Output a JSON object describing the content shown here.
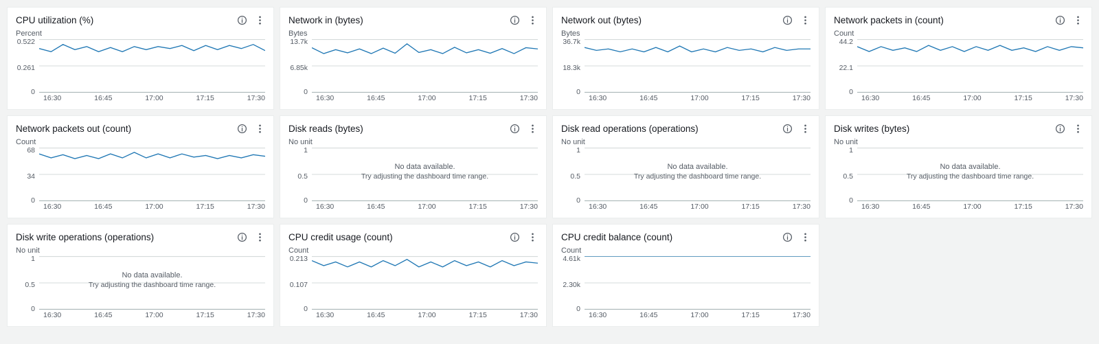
{
  "common": {
    "x_ticks": [
      "16:30",
      "16:45",
      "17:00",
      "17:15",
      "17:30"
    ],
    "no_data_line1": "No data available.",
    "no_data_line2": "Try adjusting the dashboard time range."
  },
  "cards": [
    {
      "id": "cpu-util",
      "title": "CPU utilization (%)",
      "unit": "Percent",
      "y_ticks": [
        "0.522",
        "0.261",
        "0"
      ],
      "has_data": true,
      "values": [
        0.43,
        0.4,
        0.47,
        0.42,
        0.45,
        0.4,
        0.44,
        0.4,
        0.45,
        0.42,
        0.45,
        0.43,
        0.46,
        0.41,
        0.46,
        0.42,
        0.46,
        0.43,
        0.47,
        0.41
      ],
      "ymax": 0.522
    },
    {
      "id": "net-in",
      "title": "Network in (bytes)",
      "unit": "Bytes",
      "y_ticks": [
        "13.7k",
        "6.85k",
        "0"
      ],
      "has_data": true,
      "values": [
        11.5,
        10.0,
        11.0,
        10.2,
        11.2,
        10.0,
        11.4,
        10.1,
        12.5,
        10.3,
        11.0,
        10.0,
        11.6,
        10.2,
        11.0,
        10.1,
        11.3,
        10.0,
        11.5,
        11.2
      ],
      "ymax": 13.7
    },
    {
      "id": "net-out",
      "title": "Network out (bytes)",
      "unit": "Bytes",
      "y_ticks": [
        "36.7k",
        "18.3k",
        "0"
      ],
      "has_data": true,
      "values": [
        31,
        29,
        30,
        28,
        30,
        28,
        31,
        28,
        32,
        28,
        30,
        28,
        31,
        29,
        30,
        28,
        31,
        29,
        30,
        30
      ],
      "ymax": 36.7
    },
    {
      "id": "net-pkt-in",
      "title": "Network packets in (count)",
      "unit": "Count",
      "y_ticks": [
        "44.2",
        "22.1",
        "0"
      ],
      "has_data": true,
      "values": [
        38,
        34,
        38,
        35,
        37,
        34,
        39,
        35,
        38,
        34,
        38,
        35,
        39,
        35,
        37,
        34,
        38,
        35,
        38,
        37
      ],
      "ymax": 44.2
    },
    {
      "id": "net-pkt-out",
      "title": "Network packets out (count)",
      "unit": "Count",
      "y_ticks": [
        "68",
        "34",
        "0"
      ],
      "has_data": true,
      "values": [
        60,
        55,
        59,
        54,
        58,
        54,
        60,
        55,
        62,
        55,
        60,
        55,
        60,
        56,
        58,
        54,
        58,
        55,
        59,
        57
      ],
      "ymax": 68
    },
    {
      "id": "disk-reads",
      "title": "Disk reads (bytes)",
      "unit": "No unit",
      "y_ticks": [
        "1",
        "0.5",
        "0"
      ],
      "has_data": false,
      "values": [],
      "ymax": 1
    },
    {
      "id": "disk-read-ops",
      "title": "Disk read operations (operations)",
      "unit": "No unit",
      "y_ticks": [
        "1",
        "0.5",
        "0"
      ],
      "has_data": false,
      "values": [],
      "ymax": 1
    },
    {
      "id": "disk-writes",
      "title": "Disk writes (bytes)",
      "unit": "No unit",
      "y_ticks": [
        "1",
        "0.5",
        "0"
      ],
      "has_data": false,
      "values": [],
      "ymax": 1
    },
    {
      "id": "disk-write-ops",
      "title": "Disk write operations (operations)",
      "unit": "No unit",
      "y_ticks": [
        "1",
        "0.5",
        "0"
      ],
      "has_data": false,
      "values": [],
      "ymax": 1
    },
    {
      "id": "cpu-credit-usage",
      "title": "CPU credit usage (count)",
      "unit": "Count",
      "y_ticks": [
        "0.213",
        "0.107",
        "0"
      ],
      "has_data": true,
      "values": [
        0.195,
        0.175,
        0.19,
        0.17,
        0.19,
        0.17,
        0.195,
        0.175,
        0.2,
        0.17,
        0.19,
        0.17,
        0.195,
        0.175,
        0.19,
        0.17,
        0.195,
        0.175,
        0.19,
        0.185
      ],
      "ymax": 0.213
    },
    {
      "id": "cpu-credit-balance",
      "title": "CPU credit balance (count)",
      "unit": "Count",
      "y_ticks": [
        "4.61k",
        "2.30k",
        "0"
      ],
      "has_data": true,
      "values": [
        4.61,
        4.61,
        4.61,
        4.61,
        4.61,
        4.61,
        4.61,
        4.61,
        4.61,
        4.61,
        4.61,
        4.61,
        4.61,
        4.61,
        4.61,
        4.61,
        4.61,
        4.61,
        4.61,
        4.61
      ],
      "ymax": 4.61
    }
  ],
  "chart_data": [
    {
      "type": "line",
      "title": "CPU utilization (%)",
      "xlabel": "",
      "ylabel": "Percent",
      "x": [
        "16:30",
        "16:45",
        "17:00",
        "17:15",
        "17:30"
      ],
      "ylim": [
        0,
        0.522
      ],
      "series": [
        {
          "name": "CPU utilization",
          "values": [
            0.43,
            0.4,
            0.47,
            0.42,
            0.45,
            0.4,
            0.44,
            0.4,
            0.45,
            0.42,
            0.45,
            0.43,
            0.46,
            0.41,
            0.46,
            0.42,
            0.46,
            0.43,
            0.47,
            0.41
          ]
        }
      ]
    },
    {
      "type": "line",
      "title": "Network in (bytes)",
      "xlabel": "",
      "ylabel": "Bytes",
      "x": [
        "16:30",
        "16:45",
        "17:00",
        "17:15",
        "17:30"
      ],
      "ylim": [
        0,
        13700
      ],
      "series": [
        {
          "name": "Network in",
          "values": [
            11500,
            10000,
            11000,
            10200,
            11200,
            10000,
            11400,
            10100,
            12500,
            10300,
            11000,
            10000,
            11600,
            10200,
            11000,
            10100,
            11300,
            10000,
            11500,
            11200
          ]
        }
      ]
    },
    {
      "type": "line",
      "title": "Network out (bytes)",
      "xlabel": "",
      "ylabel": "Bytes",
      "x": [
        "16:30",
        "16:45",
        "17:00",
        "17:15",
        "17:30"
      ],
      "ylim": [
        0,
        36700
      ],
      "series": [
        {
          "name": "Network out",
          "values": [
            31000,
            29000,
            30000,
            28000,
            30000,
            28000,
            31000,
            28000,
            32000,
            28000,
            30000,
            28000,
            31000,
            29000,
            30000,
            28000,
            31000,
            29000,
            30000,
            30000
          ]
        }
      ]
    },
    {
      "type": "line",
      "title": "Network packets in (count)",
      "xlabel": "",
      "ylabel": "Count",
      "x": [
        "16:30",
        "16:45",
        "17:00",
        "17:15",
        "17:30"
      ],
      "ylim": [
        0,
        44.2
      ],
      "series": [
        {
          "name": "Network packets in",
          "values": [
            38,
            34,
            38,
            35,
            37,
            34,
            39,
            35,
            38,
            34,
            38,
            35,
            39,
            35,
            37,
            34,
            38,
            35,
            38,
            37
          ]
        }
      ]
    },
    {
      "type": "line",
      "title": "Network packets out (count)",
      "xlabel": "",
      "ylabel": "Count",
      "x": [
        "16:30",
        "16:45",
        "17:00",
        "17:15",
        "17:30"
      ],
      "ylim": [
        0,
        68
      ],
      "series": [
        {
          "name": "Network packets out",
          "values": [
            60,
            55,
            59,
            54,
            58,
            54,
            60,
            55,
            62,
            55,
            60,
            55,
            60,
            56,
            58,
            54,
            58,
            55,
            59,
            57
          ]
        }
      ]
    },
    {
      "type": "line",
      "title": "Disk reads (bytes)",
      "xlabel": "",
      "ylabel": "No unit",
      "x": [
        "16:30",
        "16:45",
        "17:00",
        "17:15",
        "17:30"
      ],
      "ylim": [
        0,
        1
      ],
      "series": [
        {
          "name": "Disk reads",
          "values": []
        }
      ]
    },
    {
      "type": "line",
      "title": "Disk read operations (operations)",
      "xlabel": "",
      "ylabel": "No unit",
      "x": [
        "16:30",
        "16:45",
        "17:00",
        "17:15",
        "17:30"
      ],
      "ylim": [
        0,
        1
      ],
      "series": [
        {
          "name": "Disk read operations",
          "values": []
        }
      ]
    },
    {
      "type": "line",
      "title": "Disk writes (bytes)",
      "xlabel": "",
      "ylabel": "No unit",
      "x": [
        "16:30",
        "16:45",
        "17:00",
        "17:15",
        "17:30"
      ],
      "ylim": [
        0,
        1
      ],
      "series": [
        {
          "name": "Disk writes",
          "values": []
        }
      ]
    },
    {
      "type": "line",
      "title": "Disk write operations (operations)",
      "xlabel": "",
      "ylabel": "No unit",
      "x": [
        "16:30",
        "16:45",
        "17:00",
        "17:15",
        "17:30"
      ],
      "ylim": [
        0,
        1
      ],
      "series": [
        {
          "name": "Disk write operations",
          "values": []
        }
      ]
    },
    {
      "type": "line",
      "title": "CPU credit usage (count)",
      "xlabel": "",
      "ylabel": "Count",
      "x": [
        "16:30",
        "16:45",
        "17:00",
        "17:15",
        "17:30"
      ],
      "ylim": [
        0,
        0.213
      ],
      "series": [
        {
          "name": "CPU credit usage",
          "values": [
            0.195,
            0.175,
            0.19,
            0.17,
            0.19,
            0.17,
            0.195,
            0.175,
            0.2,
            0.17,
            0.19,
            0.17,
            0.195,
            0.175,
            0.19,
            0.17,
            0.195,
            0.175,
            0.19,
            0.185
          ]
        }
      ]
    },
    {
      "type": "line",
      "title": "CPU credit balance (count)",
      "xlabel": "",
      "ylabel": "Count",
      "x": [
        "16:30",
        "16:45",
        "17:00",
        "17:15",
        "17:30"
      ],
      "ylim": [
        0,
        4610
      ],
      "series": [
        {
          "name": "CPU credit balance",
          "values": [
            4610,
            4610,
            4610,
            4610,
            4610,
            4610,
            4610,
            4610,
            4610,
            4610,
            4610,
            4610,
            4610,
            4610,
            4610,
            4610,
            4610,
            4610,
            4610,
            4610
          ]
        }
      ]
    }
  ]
}
